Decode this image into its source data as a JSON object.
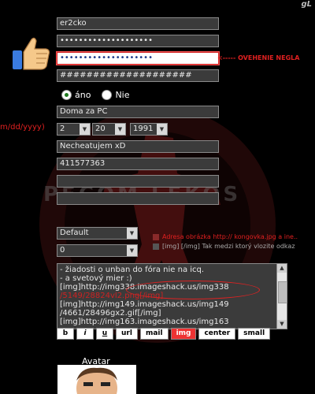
{
  "corner_logo": "gL",
  "form": {
    "fields": [
      {
        "value": "er2cko"
      },
      {
        "value": "••••••••••••••••••••"
      },
      {
        "value": "••••••••••••••••••••"
      },
      {
        "value": "####################"
      }
    ],
    "password_note": "<----- OVEHENIE NEGLA",
    "radio": {
      "yes": "áno",
      "no": "Nie"
    },
    "location": "Doma za PC",
    "date_hint": "m/dd/yyyy)",
    "date": {
      "month": "2",
      "day": "20",
      "year": "1991"
    },
    "status": "Necheatujem xD",
    "icq": "411577363",
    "empty1": "",
    "empty2": "",
    "select1": "Default",
    "select2": "0",
    "legend1": "Adresa obrázka http:// kongovka.jpg a ine..",
    "legend2": "[img]   [/img] Tak medzi ktorý vlozite odkaz",
    "textarea_lines": [
      {
        "text": "- žiadosti o unban do fóra nie na icq."
      },
      {
        "text": "- a svetový mier :)"
      },
      {
        "text": "[img]http://img338.imageshack.us/img338"
      },
      {
        "text": "/5149/28824vl2.png[/img]"
      },
      {
        "text": "[img]http://img149.imageshack.us/img149"
      },
      {
        "text": "/4661/28496gx2.gif[/img]"
      },
      {
        "text": "[img]http://img163.imageshack.us/img163"
      }
    ],
    "toolbar": [
      "b",
      "i",
      "u",
      "url",
      "mail",
      "img",
      "center",
      "small"
    ],
    "avatar_label": "Avatar"
  },
  "colors": {
    "accent_red": "#e02020",
    "field_bg": "#3b3b3b"
  }
}
